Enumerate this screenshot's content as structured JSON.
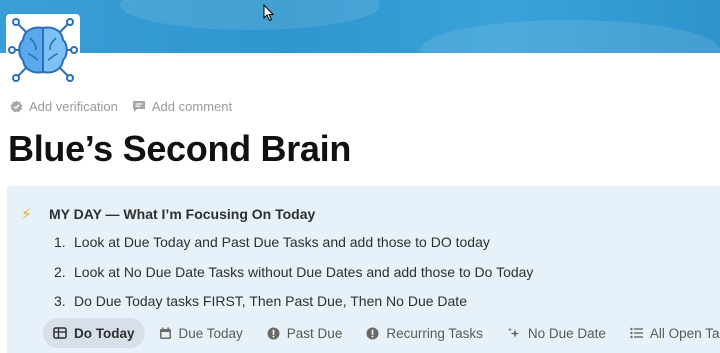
{
  "cover": {
    "color": "#3a9fd6"
  },
  "page_icon": {
    "icon": "brain-circuit-icon",
    "color": "#3b8ed8"
  },
  "meta": {
    "add_verification": "Add verification",
    "add_comment": "Add comment"
  },
  "page": {
    "title": "Blue’s Second Brain"
  },
  "callout": {
    "icon": "lightning-icon",
    "title": "MY DAY — What I’m Focusing On Today",
    "steps": [
      {
        "num": "1.",
        "text": "Look at Due Today and Past Due Tasks and add those to DO today"
      },
      {
        "num": "2.",
        "text": "Look at No Due Date Tasks without Due Dates and add those to Do Today"
      },
      {
        "num": "3.",
        "text": "Do Due Today tasks FIRST, Then Past Due, Then No Due Date"
      }
    ]
  },
  "tabs": [
    {
      "label": "Do Today",
      "icon": "table-icon",
      "active": true
    },
    {
      "label": "Due Today",
      "icon": "calendar-icon"
    },
    {
      "label": "Past Due",
      "icon": "alert-circle-icon"
    },
    {
      "label": "Recurring Tasks",
      "icon": "alert-circle-icon"
    },
    {
      "label": "No Due Date",
      "icon": "sparkles-icon"
    },
    {
      "label": "All Open Tasks",
      "icon": "list-icon"
    }
  ]
}
